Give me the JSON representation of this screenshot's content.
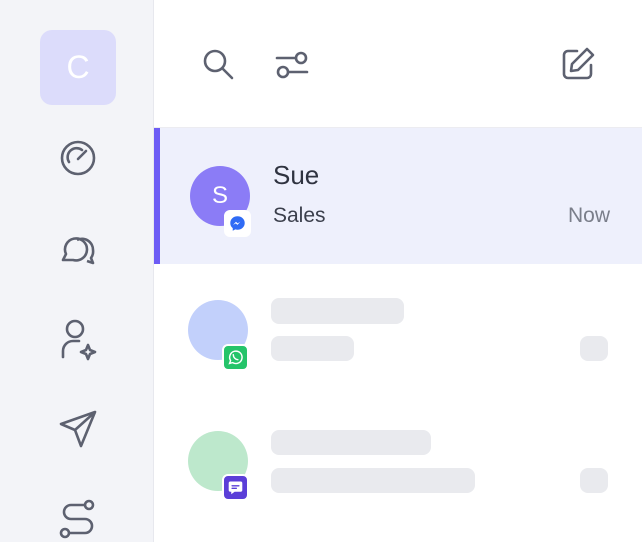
{
  "sidebar": {
    "workspace_initial": "C",
    "nav_icons": [
      "dashboard-icon",
      "chats-icon",
      "contacts-icon",
      "broadcast-icon",
      "workflows-icon"
    ]
  },
  "toolbar": {
    "icons": [
      "search-icon",
      "filter-icon",
      "compose-icon"
    ]
  },
  "conversations": [
    {
      "avatar_initial": "S",
      "name": "Sue",
      "subtitle": "Sales",
      "time": "Now",
      "channel": "messenger",
      "avatar_color": "#8b7cf6",
      "active": true
    },
    {
      "loading": true,
      "channel": "whatsapp",
      "avatar_color": "#c2d0fb"
    },
    {
      "loading": true,
      "channel": "livechat",
      "avatar_color": "#bde8cc"
    }
  ],
  "colors": {
    "accent": "#6d5cf5",
    "messenger": "#2f6bf5",
    "whatsapp": "#25c46a",
    "livechat": "#5b3fd8"
  }
}
